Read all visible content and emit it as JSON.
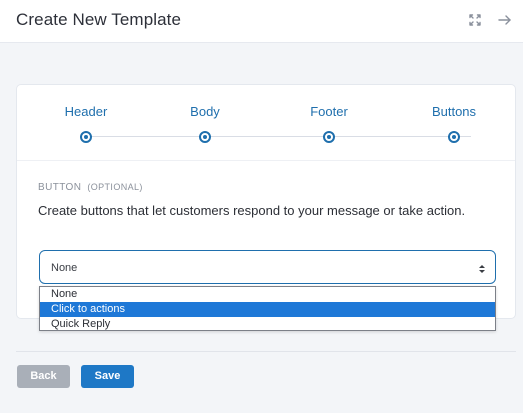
{
  "header": {
    "title": "Create New Template",
    "icons": [
      "expand-icon",
      "arrow-right-icon"
    ]
  },
  "stepper": {
    "steps": [
      {
        "label": "Header"
      },
      {
        "label": "Body"
      },
      {
        "label": "Footer"
      },
      {
        "label": "Buttons"
      }
    ],
    "active_color": "#1f6fad"
  },
  "button_section": {
    "label": "BUTTON",
    "optional_label": "(OPTIONAL)",
    "description": "Create buttons that let customers respond to your message or take action.",
    "select_value": "None",
    "options": [
      "None",
      "Click to actions",
      "Quick Reply"
    ],
    "highlighted_option": "Click to actions"
  },
  "footer": {
    "back_label": "Back",
    "save_label": "Save"
  },
  "colors": {
    "accent": "#1f6fad",
    "highlight": "#1e78d7",
    "save": "#1e78c6",
    "back": "#a9afb8"
  }
}
